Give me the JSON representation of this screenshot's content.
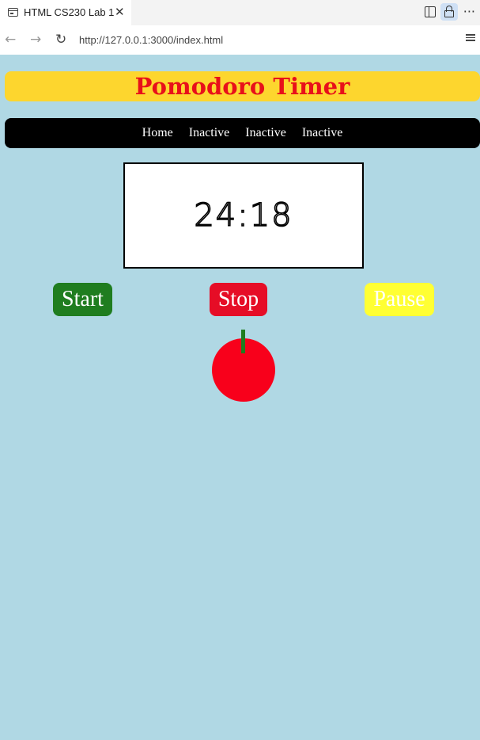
{
  "browser": {
    "tab_title": "HTML CS230 Lab 1",
    "tab_close": "✕",
    "url": "http://127.0.0.1:3000/index.html",
    "back": "←",
    "forward": "→",
    "reload": "↻",
    "more": "···"
  },
  "page": {
    "title": "Pomodoro Timer",
    "nav": [
      "Home",
      "Inactive",
      "Inactive",
      "Inactive"
    ],
    "timer": "24:18",
    "buttons": {
      "start": "Start",
      "stop": "Stop",
      "pause": "Pause"
    }
  },
  "colors": {
    "background": "#b0d8e4",
    "title_bg": "#fdd62e",
    "title_text": "#e8101a",
    "start": "#1f7d1f",
    "stop": "#e60d26",
    "pause": "#ffff33",
    "tomato": "#f8001b"
  }
}
